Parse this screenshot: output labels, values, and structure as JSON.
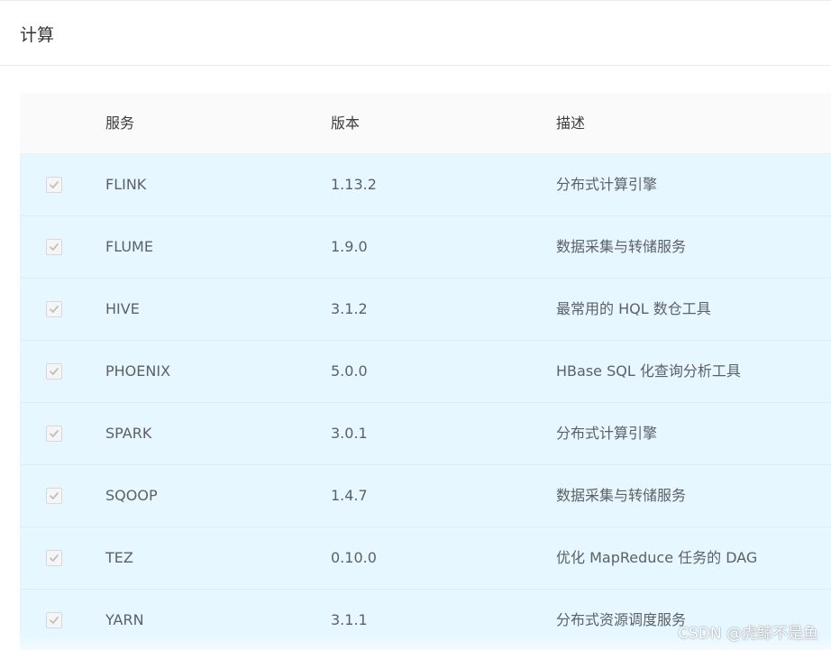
{
  "section": {
    "title": "计算"
  },
  "table": {
    "headers": {
      "service": "服务",
      "version": "版本",
      "description": "描述"
    },
    "rows": [
      {
        "checked": true,
        "service": "FLINK",
        "version": "1.13.2",
        "description": "分布式计算引擎"
      },
      {
        "checked": true,
        "service": "FLUME",
        "version": "1.9.0",
        "description": "数据采集与转储服务"
      },
      {
        "checked": true,
        "service": "HIVE",
        "version": "3.1.2",
        "description": "最常用的 HQL 数仓工具"
      },
      {
        "checked": true,
        "service": "PHOENIX",
        "version": "5.0.0",
        "description": "HBase SQL 化查询分析工具"
      },
      {
        "checked": true,
        "service": "SPARK",
        "version": "3.0.1",
        "description": "分布式计算引擎"
      },
      {
        "checked": true,
        "service": "SQOOP",
        "version": "1.4.7",
        "description": "数据采集与转储服务"
      },
      {
        "checked": true,
        "service": "TEZ",
        "version": "0.10.0",
        "description": "优化 MapReduce 任务的 DAG"
      },
      {
        "checked": true,
        "service": "YARN",
        "version": "3.1.1",
        "description": "分布式资源调度服务"
      }
    ]
  },
  "watermark": "CSDN @虎鲸不是鱼",
  "colors": {
    "selected_row_bg": "#e6f7ff",
    "header_bg": "#fafafa",
    "checkbox_disabled_bg": "#f5f5f5",
    "checkmark": "#bfbfbf"
  }
}
